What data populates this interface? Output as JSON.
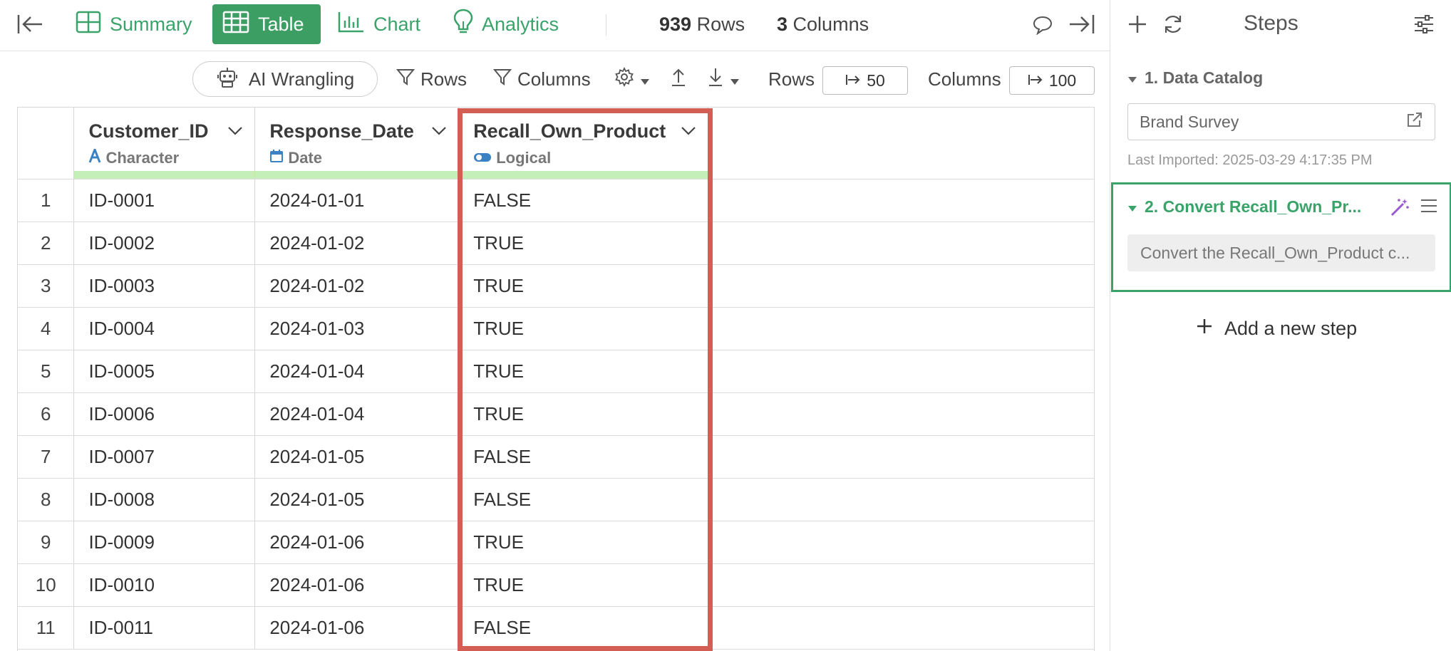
{
  "top_bar": {
    "tabs": [
      {
        "label": "Summary",
        "icon": "summary-grid-icon"
      },
      {
        "label": "Table",
        "icon": "table-icon",
        "active": true
      },
      {
        "label": "Chart",
        "icon": "bar-chart-icon"
      },
      {
        "label": "Analytics",
        "icon": "lightbulb-icon"
      }
    ],
    "rows_count": "939",
    "rows_label": "Rows",
    "columns_count": "3",
    "columns_label": "Columns"
  },
  "toolbar": {
    "ai_button": "AI Wrangling",
    "rows_filter": "Rows",
    "columns_filter": "Columns",
    "rows_label": "Rows",
    "rows_limit": "50",
    "columns_label": "Columns",
    "columns_limit": "100"
  },
  "table": {
    "columns": [
      {
        "name": "Customer_ID",
        "type": "Character",
        "type_icon": "character-type-icon"
      },
      {
        "name": "Response_Date",
        "type": "Date",
        "type_icon": "calendar-icon"
      },
      {
        "name": "Recall_Own_Product",
        "type": "Logical",
        "type_icon": "toggle-icon"
      }
    ],
    "rows": [
      [
        "1",
        "ID-0001",
        "2024-01-01",
        "FALSE"
      ],
      [
        "2",
        "ID-0002",
        "2024-01-02",
        "TRUE"
      ],
      [
        "3",
        "ID-0003",
        "2024-01-02",
        "TRUE"
      ],
      [
        "4",
        "ID-0004",
        "2024-01-03",
        "TRUE"
      ],
      [
        "5",
        "ID-0005",
        "2024-01-04",
        "TRUE"
      ],
      [
        "6",
        "ID-0006",
        "2024-01-04",
        "TRUE"
      ],
      [
        "7",
        "ID-0007",
        "2024-01-05",
        "FALSE"
      ],
      [
        "8",
        "ID-0008",
        "2024-01-05",
        "FALSE"
      ],
      [
        "9",
        "ID-0009",
        "2024-01-06",
        "TRUE"
      ],
      [
        "10",
        "ID-0010",
        "2024-01-06",
        "TRUE"
      ],
      [
        "11",
        "ID-0011",
        "2024-01-06",
        "FALSE"
      ]
    ],
    "highlight_color": "#d35f54"
  },
  "panel": {
    "title": "Steps",
    "steps": [
      {
        "title": "1. Data Catalog",
        "source": "Brand Survey",
        "last_imported": "Last Imported: 2025-03-29 4:17:35 PM"
      },
      {
        "title": "2. Convert Recall_Own_Pr...",
        "description": "Convert the Recall_Own_Product c..."
      }
    ],
    "add_step": "Add a new step"
  },
  "colors": {
    "accent_green": "#3aa36a",
    "active_tab": "#3d9e63",
    "header_strip": "#c5efb9",
    "magic_purple": "#9b59d0"
  }
}
